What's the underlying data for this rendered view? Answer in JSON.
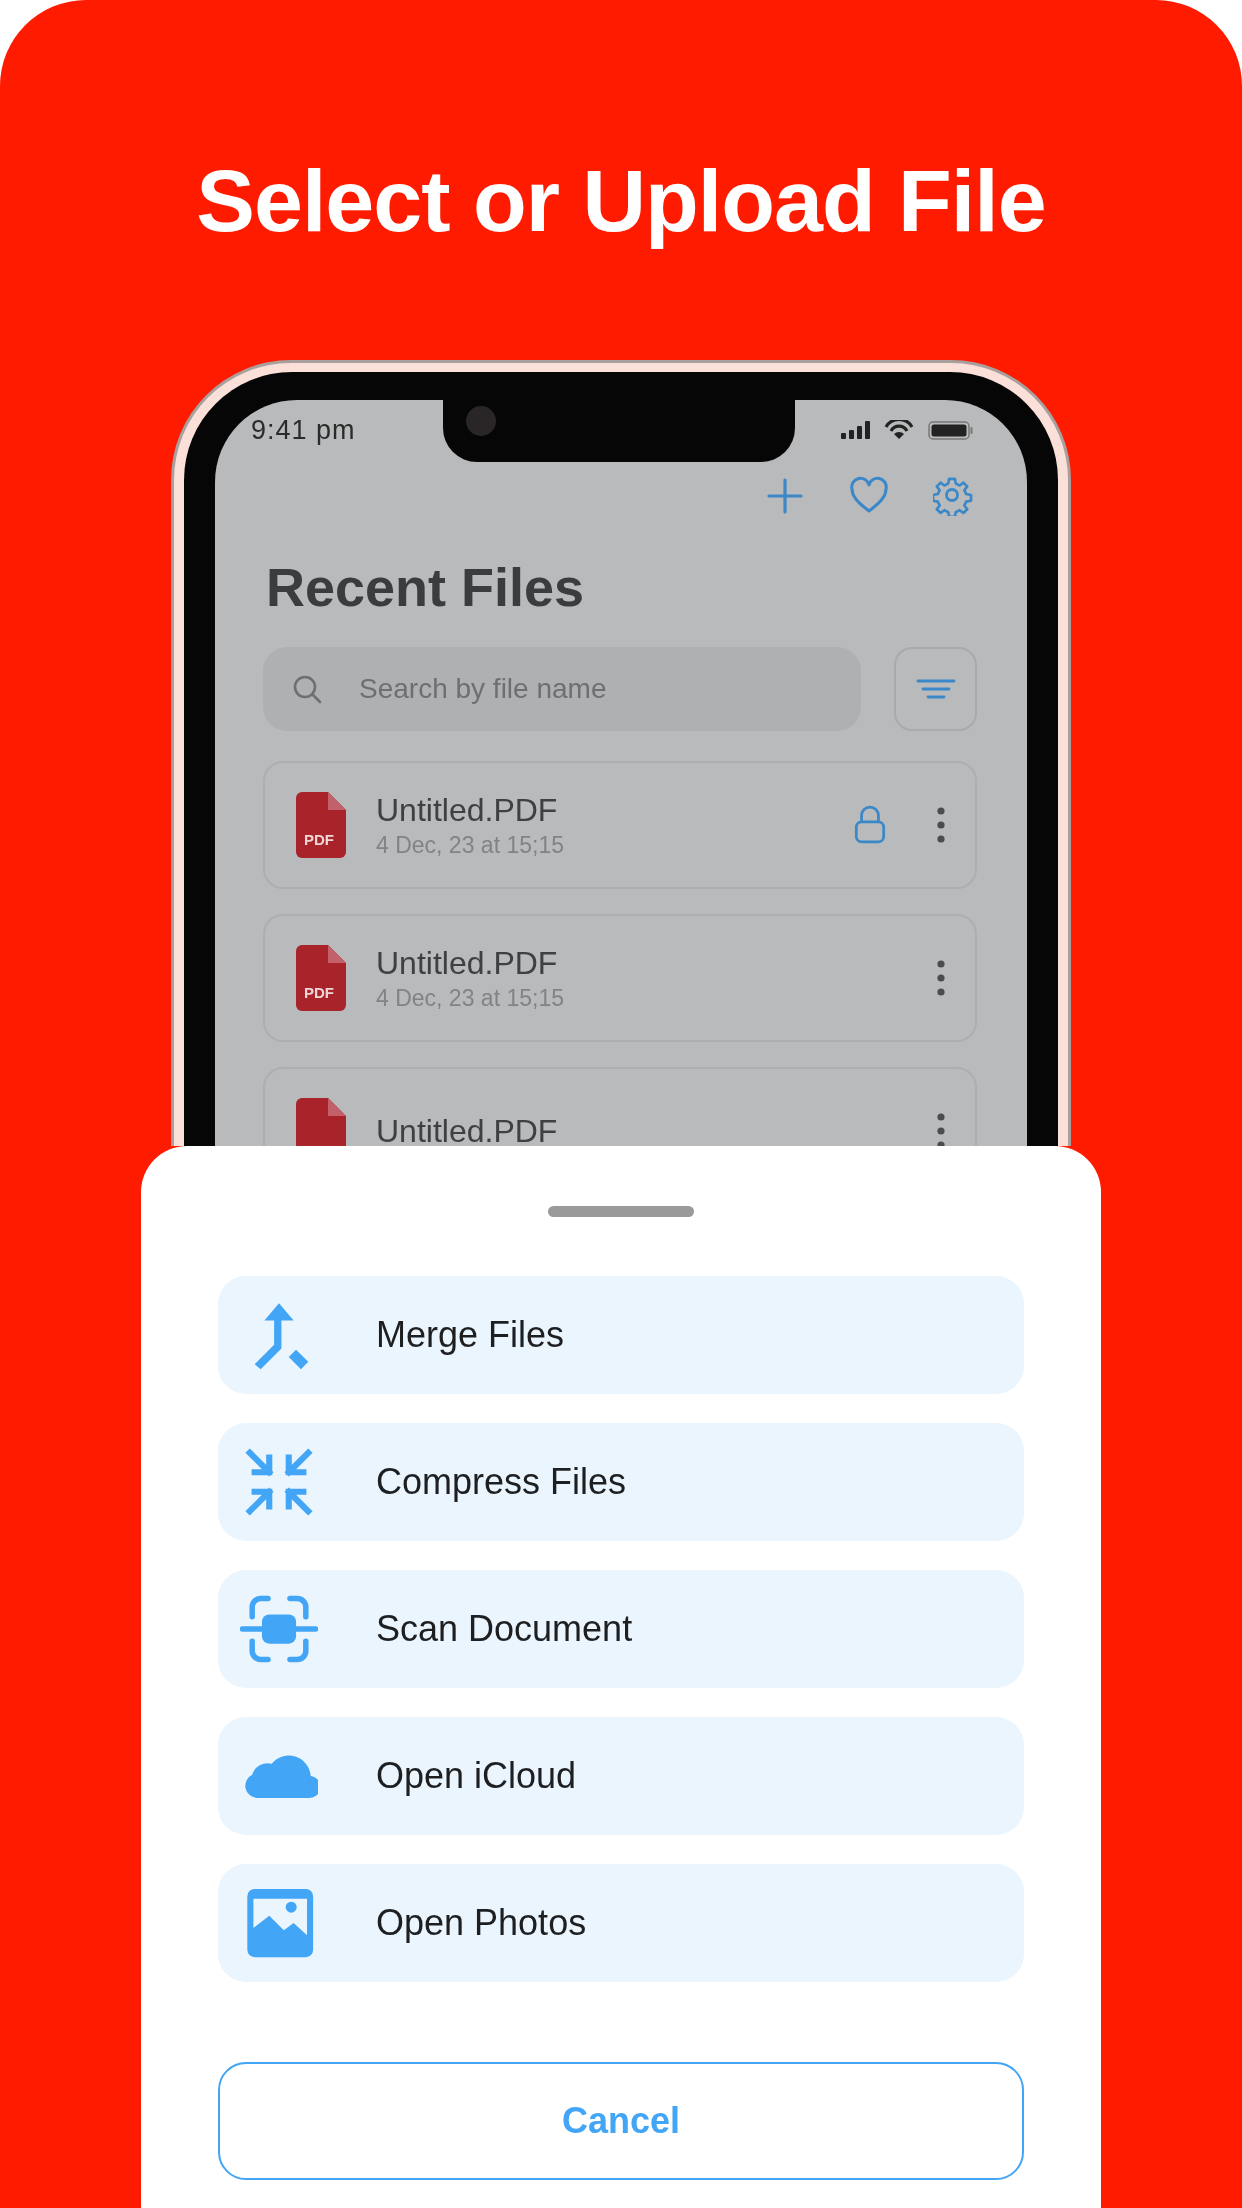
{
  "headline": "Select or Upload File",
  "phone": {
    "status_bar": {
      "time": "9:41 pm"
    },
    "title": "Recent Files",
    "search": {
      "placeholder": "Search by file name"
    },
    "files": [
      {
        "name": "Untitled.PDF",
        "date": "4 Dec, 23 at 15;15",
        "badge": "PDF",
        "locked": true
      },
      {
        "name": "Untitled.PDF",
        "date": "4 Dec, 23 at 15;15",
        "badge": "PDF",
        "locked": false
      },
      {
        "name": "Untitled.PDF",
        "locked": false
      }
    ]
  },
  "sheet": {
    "actions": [
      {
        "label": "Merge Files",
        "kind": "merge"
      },
      {
        "label": "Compress Files",
        "kind": "compress"
      },
      {
        "label": "Scan Document",
        "kind": "scan"
      },
      {
        "label": "Open iCloud",
        "kind": "cloud"
      },
      {
        "label": "Open Photos",
        "kind": "photos"
      }
    ],
    "cancel": "Cancel"
  }
}
